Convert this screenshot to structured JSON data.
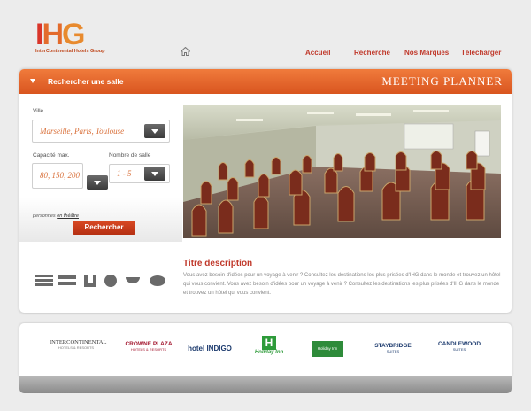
{
  "header": {
    "logo": {
      "letters": "IHG",
      "subtitle": "InterContinental Hotels Group"
    },
    "nav": [
      "Accueil",
      "Recherche",
      "Nos Marques",
      "Télécharger"
    ]
  },
  "bar": {
    "search_label": "Rechercher une salle",
    "title": "MEETING PLANNER"
  },
  "form": {
    "ville_label": "Ville",
    "ville_value": "Marseille, Paris, Toulouse",
    "capacite_label": "Capacité max.",
    "capacite_value": "80, 150, 200",
    "nombre_label": "Nombre de salle",
    "nombre_value": "1 - 5",
    "note_prefix": "personnes",
    "note_link": "en théâtre",
    "submit_label": "Rechercher"
  },
  "description": {
    "title": "Titre description",
    "text": "Vous avez besoin d'idées pour un voyage à venir ? Consultez les destinations les plus prisées d'IHG dans le monde et trouvez un hôtel qui vous convient. Vous avez besoin d'idées pour un voyage à venir ? Consultez les destinations les plus prisées d'IHG dans le monde et trouvez un hôtel qui vous convient."
  },
  "brands": {
    "intercontinental": {
      "name": "INTERCONTINENTAL",
      "tag": "HOTELS & RESORTS"
    },
    "crowne": {
      "name": "CROWNE PLAZA",
      "tag": "HOTELS & RESORTS"
    },
    "indigo": {
      "name": "hotel INDIGO"
    },
    "holidayinn": {
      "name": "Holiday Inn"
    },
    "express": {
      "name": "Holiday Inn Express"
    },
    "staybridge": {
      "name": "STAYBRIDGE",
      "tag": "SUITES"
    },
    "candlewood": {
      "name": "CANDLEWOOD",
      "tag": "SUITES"
    }
  },
  "colors": {
    "accent": "#e36b2c",
    "red": "#c0392b",
    "bar": "#e0602a"
  }
}
